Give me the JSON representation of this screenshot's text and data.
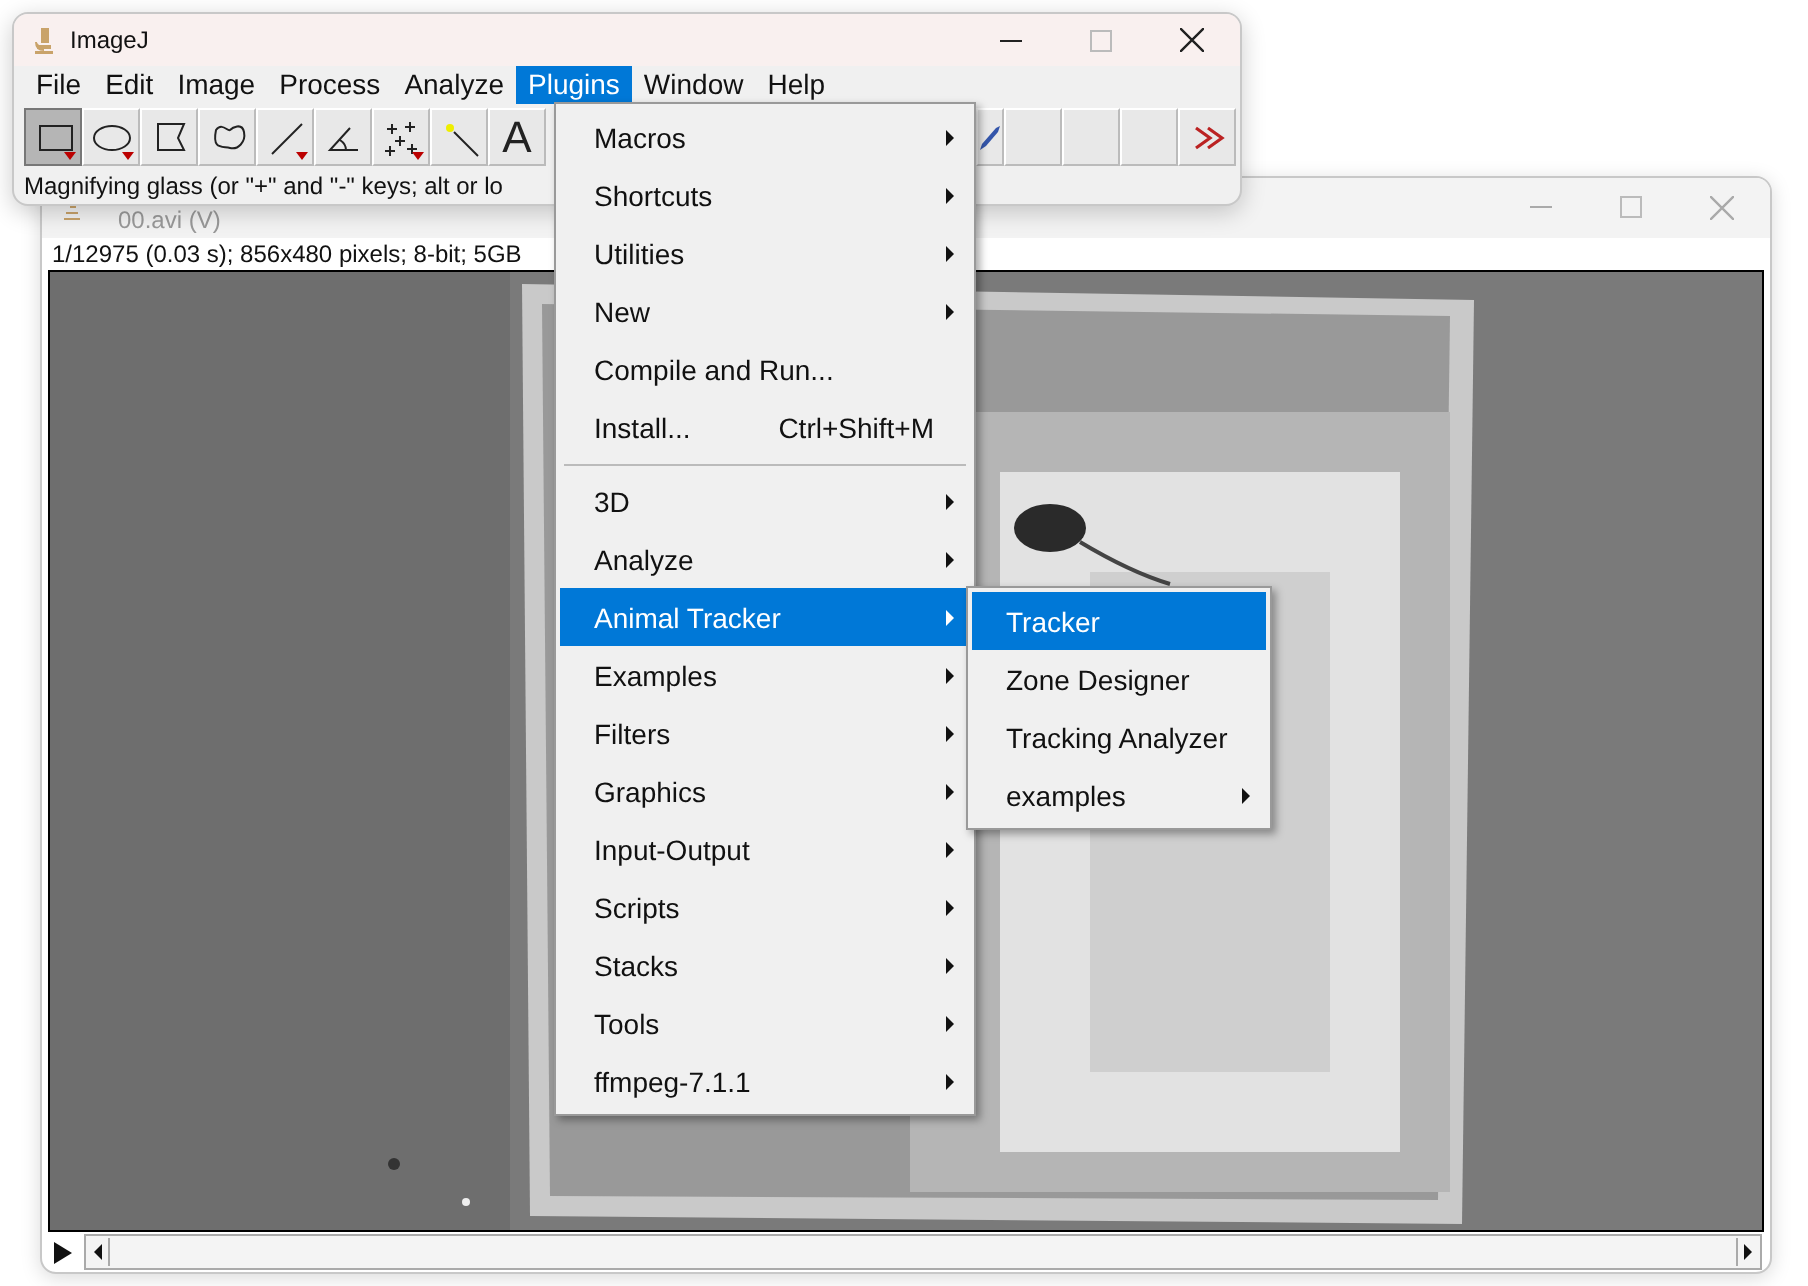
{
  "image_window": {
    "title": "00.avi (V)",
    "info": "1/12975 (0.03 s); 856x480 pixels; 8-bit; 5GB"
  },
  "imagej": {
    "title": "ImageJ",
    "menu": [
      {
        "label": "File",
        "selected": false
      },
      {
        "label": "Edit",
        "selected": false
      },
      {
        "label": "Image",
        "selected": false
      },
      {
        "label": "Process",
        "selected": false
      },
      {
        "label": "Analyze",
        "selected": false
      },
      {
        "label": "Plugins",
        "selected": true
      },
      {
        "label": "Window",
        "selected": false
      },
      {
        "label": "Help",
        "selected": false
      }
    ],
    "tools": [
      {
        "kind": "rectangle",
        "selected": true,
        "dropdown": true
      },
      {
        "kind": "oval",
        "selected": false,
        "dropdown": true
      },
      {
        "kind": "polygon",
        "selected": false
      },
      {
        "kind": "freehand",
        "selected": false
      },
      {
        "kind": "line",
        "selected": false,
        "dropdown": true
      },
      {
        "kind": "angle",
        "selected": false
      },
      {
        "kind": "point",
        "selected": false,
        "dropdown": true
      },
      {
        "kind": "wand",
        "selected": false
      },
      {
        "kind": "text",
        "label": "A",
        "selected": false
      },
      {
        "kind": "dropper",
        "selected": false
      },
      {
        "kind": "blank",
        "selected": false
      },
      {
        "kind": "blank",
        "selected": false
      },
      {
        "kind": "blank",
        "selected": false
      },
      {
        "kind": "more",
        "selected": false
      }
    ],
    "status": "Magnifying glass (or \"+\" and \"-\" keys; alt or lo"
  },
  "plugins_menu": [
    {
      "kind": "item",
      "label": "Macros",
      "submenu": true,
      "selected": false
    },
    {
      "kind": "item",
      "label": "Shortcuts",
      "submenu": true,
      "selected": false
    },
    {
      "kind": "item",
      "label": "Utilities",
      "submenu": true,
      "selected": false
    },
    {
      "kind": "item",
      "label": "New",
      "submenu": true,
      "selected": false
    },
    {
      "kind": "item",
      "label": "Compile and Run...",
      "submenu": false,
      "selected": false
    },
    {
      "kind": "item",
      "label": "Install...",
      "shortcut": "Ctrl+Shift+M",
      "submenu": false,
      "selected": false
    },
    {
      "kind": "separator"
    },
    {
      "kind": "item",
      "label": "3D",
      "submenu": true,
      "selected": false
    },
    {
      "kind": "item",
      "label": "Analyze",
      "submenu": true,
      "selected": false
    },
    {
      "kind": "item",
      "label": "Animal Tracker",
      "submenu": true,
      "selected": true
    },
    {
      "kind": "item",
      "label": "Examples",
      "submenu": true,
      "selected": false
    },
    {
      "kind": "item",
      "label": "Filters",
      "submenu": true,
      "selected": false
    },
    {
      "kind": "item",
      "label": "Graphics",
      "submenu": true,
      "selected": false
    },
    {
      "kind": "item",
      "label": "Input-Output",
      "submenu": true,
      "selected": false
    },
    {
      "kind": "item",
      "label": "Scripts",
      "submenu": true,
      "selected": false
    },
    {
      "kind": "item",
      "label": "Stacks",
      "submenu": true,
      "selected": false
    },
    {
      "kind": "item",
      "label": "Tools",
      "submenu": true,
      "selected": false
    },
    {
      "kind": "item",
      "label": "ffmpeg-7.1.1",
      "submenu": true,
      "selected": false
    }
  ],
  "animal_tracker_menu": [
    {
      "kind": "item",
      "label": "Tracker",
      "submenu": false,
      "selected": true
    },
    {
      "kind": "item",
      "label": "Zone Designer",
      "submenu": false,
      "selected": false
    },
    {
      "kind": "item",
      "label": "Tracking Analyzer",
      "submenu": false,
      "selected": false
    },
    {
      "kind": "item",
      "label": "examples",
      "submenu": true,
      "selected": false
    }
  ]
}
